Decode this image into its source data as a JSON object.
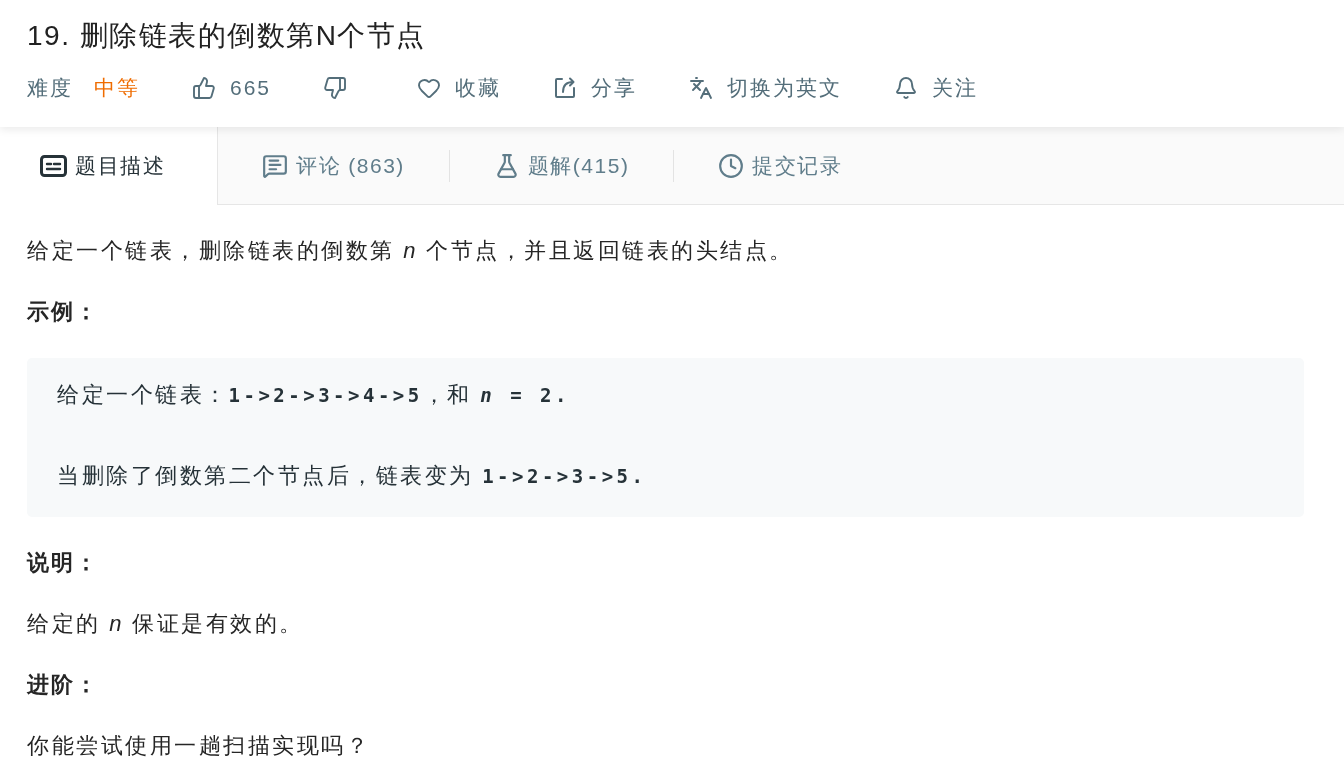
{
  "problem": {
    "title": "19. 删除链表的倒数第N个节点"
  },
  "meta_bar": {
    "difficulty_label": "难度",
    "difficulty": {
      "text": "中等",
      "kind": "medium"
    },
    "actions": [
      {
        "kind": "like",
        "label": "665"
      },
      {
        "kind": "dislike"
      },
      {
        "kind": "favorite",
        "label": "收藏"
      },
      {
        "kind": "share",
        "label": "分享"
      },
      {
        "kind": "translate",
        "label": "切换为英文"
      },
      {
        "kind": "follow",
        "label": "关注"
      }
    ]
  },
  "tabs": [
    {
      "kind": "description",
      "label": "题目描述",
      "selected": true
    },
    {
      "kind": "comments",
      "label": "评论 (863)",
      "selected": false
    },
    {
      "kind": "solutions",
      "label": "题解(415)",
      "selected": false
    },
    {
      "kind": "submissions",
      "label": "提交记录",
      "selected": false
    }
  ],
  "content": [
    {
      "kind": "paragraph",
      "text": "给定一个链表，删除链表的倒数第 *n* 个节点，并且返回链表的头结点。"
    },
    {
      "kind": "heading",
      "text": "示例："
    },
    {
      "kind": "example",
      "lines": [
        [
          {
            "kind": "text",
            "text": "给定一个链表："
          },
          {
            "kind": "code",
            "text": "1->2->3->4->5"
          },
          {
            "kind": "text",
            "text": "，和 "
          },
          {
            "kind": "code",
            "text": "*n* = 2."
          }
        ],
        [
          {
            "kind": "text",
            "text": "当删除了倒数第二个节点后，链表变为 "
          },
          {
            "kind": "code",
            "text": "1->2->3->5."
          }
        ]
      ]
    },
    {
      "kind": "heading",
      "text": "说明："
    },
    {
      "kind": "paragraph",
      "text": "给定的 *n* 保证是有效的。"
    },
    {
      "kind": "heading",
      "text": "进阶："
    },
    {
      "kind": "paragraph",
      "text": "你能尝试使用一趟扫描实现吗？"
    }
  ]
}
